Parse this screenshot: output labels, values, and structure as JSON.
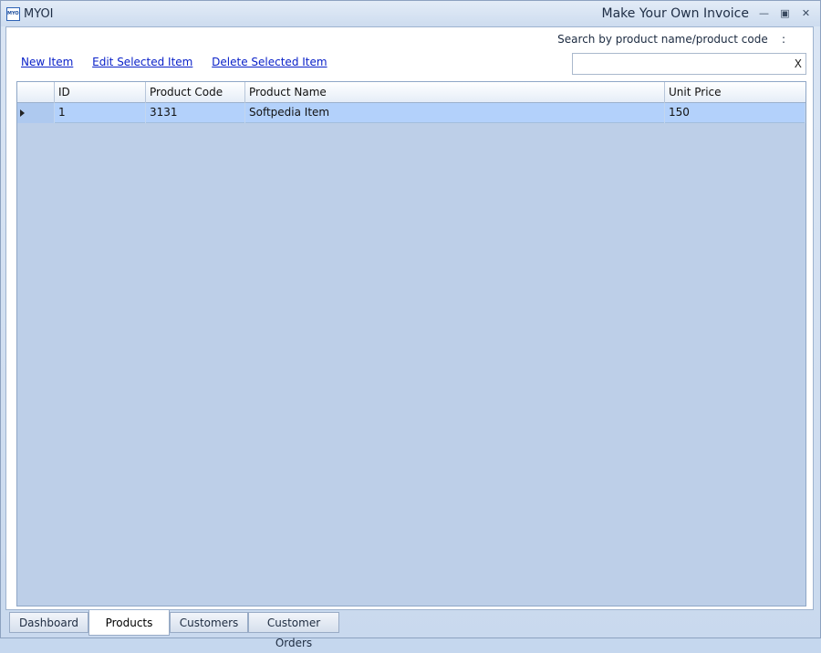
{
  "titlebar": {
    "app_icon_text": "MYOI",
    "app_name": "MYOI",
    "window_title": "Make Your Own Invoice",
    "minimize_glyph": "—",
    "maximize_glyph": "▣",
    "close_glyph": "✕"
  },
  "search": {
    "label": "Search by product name/product code    :",
    "value": "",
    "placeholder": "",
    "clear_label": "X"
  },
  "actions": {
    "new_item": "New Item",
    "edit_item": "Edit Selected Item",
    "delete_item": "Delete Selected Item"
  },
  "grid": {
    "columns": [
      "",
      "ID",
      "Product Code",
      "Product Name",
      "Unit Price"
    ],
    "rows": [
      {
        "id": "1",
        "code": "3131",
        "name": "Softpedia Item",
        "price": "150"
      }
    ]
  },
  "tabs": [
    {
      "label": "Dashboard",
      "active": false
    },
    {
      "label": "Products",
      "active": true
    },
    {
      "label": "Customers",
      "active": false
    },
    {
      "label": "Customer Orders",
      "active": false
    }
  ],
  "colors": {
    "selected_row": "#b3d1fb",
    "grid_background": "#bdcfe8",
    "link": "#0b22c9"
  }
}
